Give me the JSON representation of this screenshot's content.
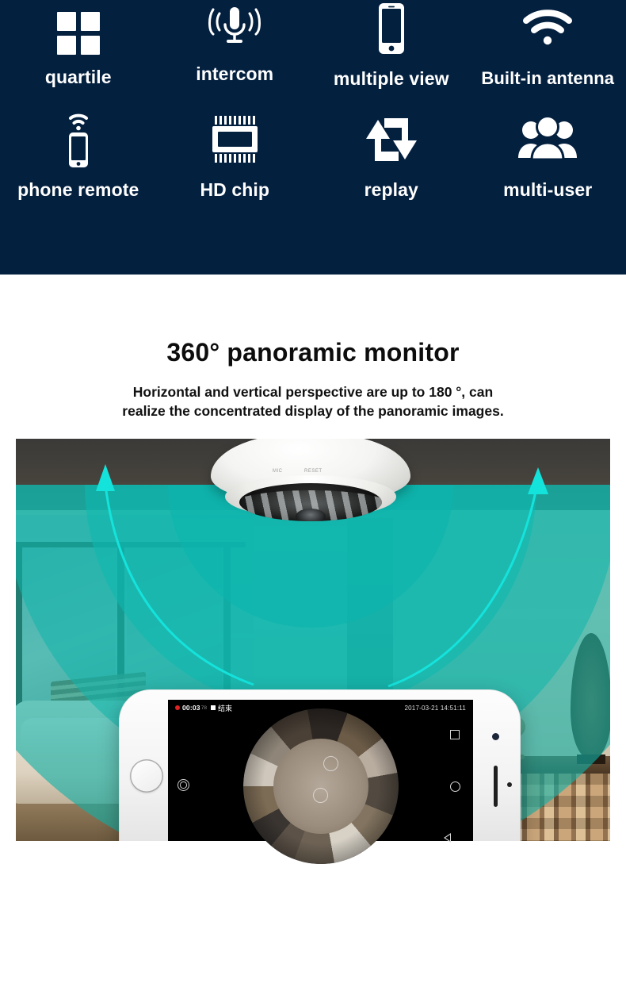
{
  "banner": {
    "background_color": "#04203f",
    "features": [
      {
        "icon": "quartile-grid-icon",
        "label": "quartile"
      },
      {
        "icon": "microphone-icon",
        "label": "intercom"
      },
      {
        "icon": "smartphone-icon",
        "label": "multiple view"
      },
      {
        "icon": "wifi-icon",
        "label": "Built-in antenna"
      },
      {
        "icon": "phone-signal-icon",
        "label": "phone remote"
      },
      {
        "icon": "chip-icon",
        "label": "HD chip"
      },
      {
        "icon": "replay-arrows-icon",
        "label": "replay"
      },
      {
        "icon": "users-group-icon",
        "label": "multi-user"
      }
    ]
  },
  "heading": {
    "title": "360° panoramic monitor",
    "subtitle_line1": "Horizontal and vertical perspective are up to 180 °, can",
    "subtitle_line2": "realize the concentrated display of the panoramic images."
  },
  "scene": {
    "description": "Living room with ceiling-mounted white fisheye dome camera emitting teal 180° coverage arcs, with curved cyan arrows pointing up at both sides",
    "accent_color": "#19bfb4",
    "arrow_color": "#16e0e0",
    "camera_labels": {
      "left": "MIC",
      "right": "RESET"
    }
  },
  "phone": {
    "status_bar": {
      "record_indicator": "record-dot",
      "timer": "00:03",
      "timer_ms": "78",
      "stop_label": "结束",
      "timestamp": "2017-03-21 14:51:11"
    },
    "screen": {
      "view": "fisheye-360-cafe-interior",
      "snapshot_icon": "capture-icon"
    },
    "nav_buttons": [
      {
        "icon": "square-recents-icon"
      },
      {
        "icon": "circle-home-icon"
      },
      {
        "icon": "triangle-back-icon"
      }
    ],
    "hardware": {
      "home_button": "home-button",
      "front_camera": "front-camera-dot",
      "speaker": "earpiece-speaker"
    }
  }
}
